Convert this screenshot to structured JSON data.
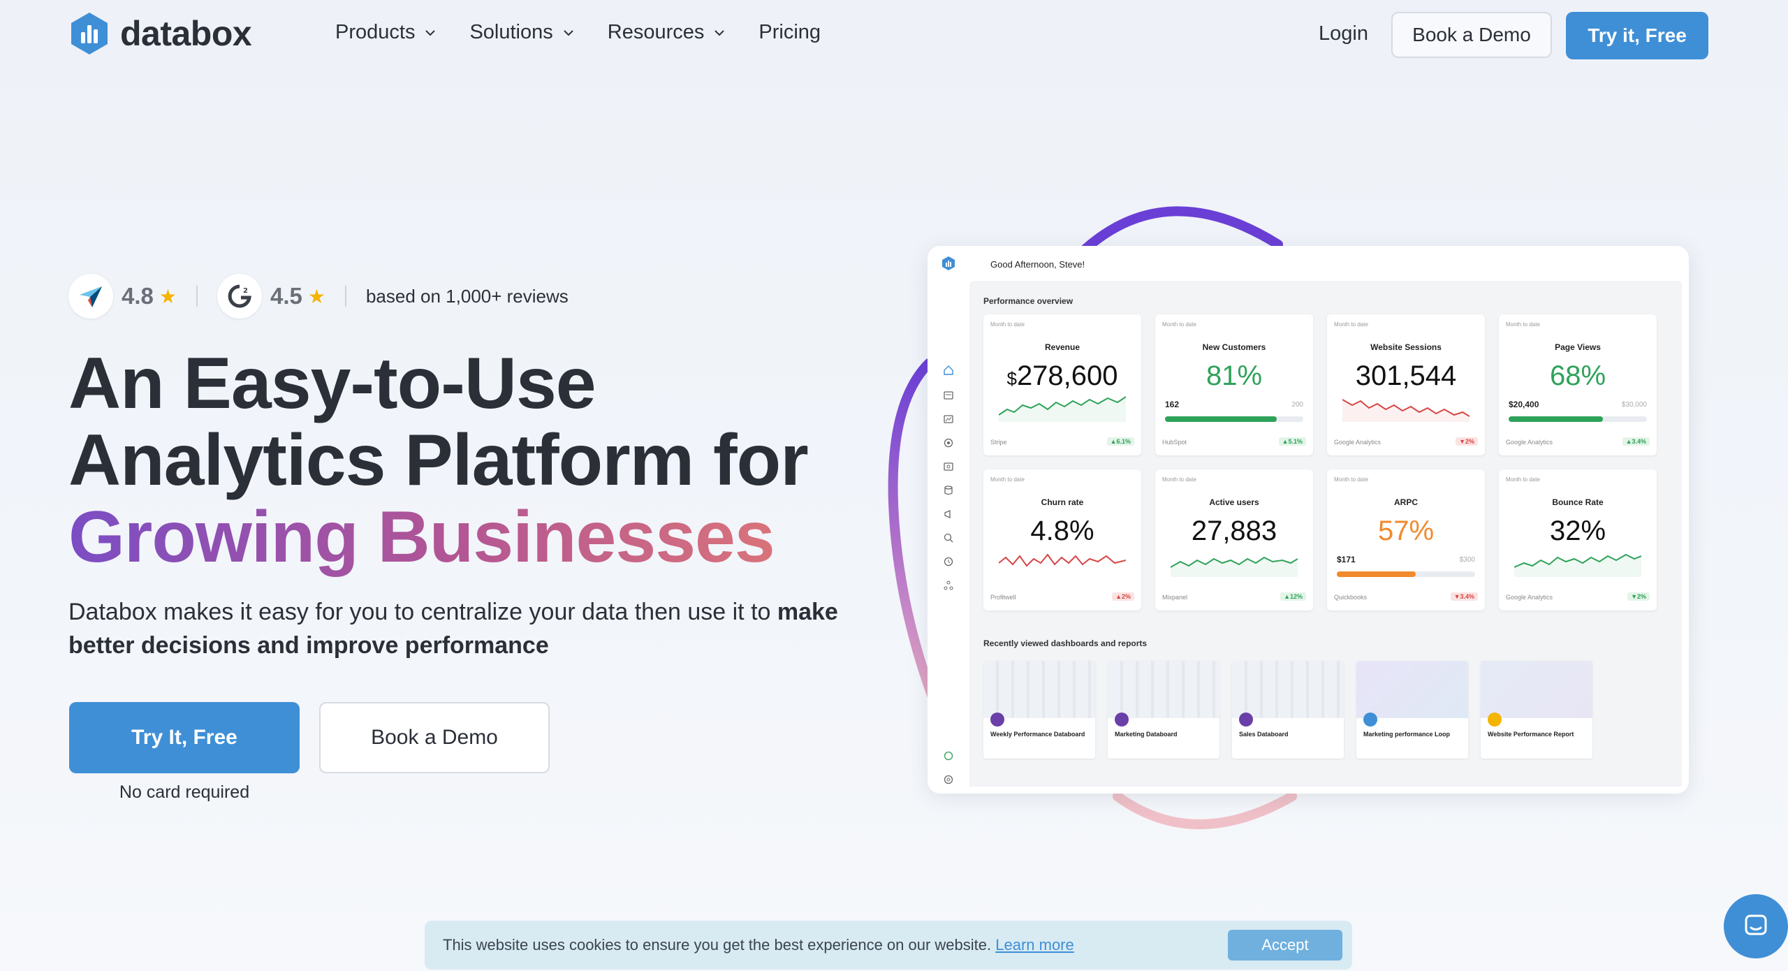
{
  "nav": {
    "brand": "databox",
    "menu": [
      "Products",
      "Solutions",
      "Resources",
      "Pricing"
    ],
    "login": "Login",
    "demo": "Book a Demo",
    "try": "Try it, Free"
  },
  "hero": {
    "rating1": "4.8",
    "rating2": "4.5",
    "reviews": "based on 1,000+ reviews",
    "line1": "An Easy-to-Use",
    "line2": "Analytics Platform for",
    "line3": "Growing Businesses",
    "sub_plain": "Databox makes it easy for you to centralize your data then use it to ",
    "sub_bold": "make better decisions and improve performance",
    "cta_primary": "Try It, Free",
    "cta_secondary": "Book a Demo",
    "note": "No card required"
  },
  "dashboard": {
    "greeting": "Good Afternoon, Steve!",
    "perf_title": "Performance overview",
    "mtd": "Month to date",
    "cards": [
      {
        "title": "Revenue",
        "prefix": "$",
        "value": "278,600",
        "source": "Stripe",
        "change": "▲6.1%",
        "dir": "up"
      },
      {
        "title": "New Customers",
        "value": "81%",
        "source": "HubSpot",
        "change": "▲5.1%",
        "dir": "up",
        "left": "162",
        "right": "200",
        "fill": 0.81
      },
      {
        "title": "Website Sessions",
        "value": "301,544",
        "source": "Google Analytics",
        "change": "▼2%",
        "dir": "down"
      },
      {
        "title": "Page Views",
        "value": "68%",
        "source": "Google Analytics",
        "change": "▲3.4%",
        "dir": "up",
        "left": "$20,400",
        "right": "$30,000",
        "fill": 0.68
      },
      {
        "title": "Churn rate",
        "value": "4.8%",
        "source": "Profitwell",
        "change": "▲2%",
        "dir": "down"
      },
      {
        "title": "Active users",
        "value": "27,883",
        "source": "Mixpanel",
        "change": "▲12%",
        "dir": "up"
      },
      {
        "title": "ARPC",
        "value": "57%",
        "source": "Quickbooks",
        "change": "▼3.4%",
        "dir": "down",
        "left": "$171",
        "right": "$300",
        "fill": 0.57
      },
      {
        "title": "Bounce Rate",
        "value": "32%",
        "source": "Google Analytics",
        "change": "▼2%",
        "dir": "up"
      }
    ],
    "recent_title": "Recently viewed dashboards and reports",
    "recent": [
      "Weekly Performance Databoard",
      "Marketing Databoard",
      "Sales Databoard",
      "Marketing performance Loop",
      "Website Performance Report"
    ]
  },
  "cookie": {
    "text": "This website uses cookies to ensure you get the best experience on our website. ",
    "link": "Learn more",
    "accept": "Accept"
  },
  "colors": {
    "primary": "#3f8fd6",
    "up": "#2ea25a",
    "down": "#d64545",
    "warn": "#f08a2c"
  }
}
